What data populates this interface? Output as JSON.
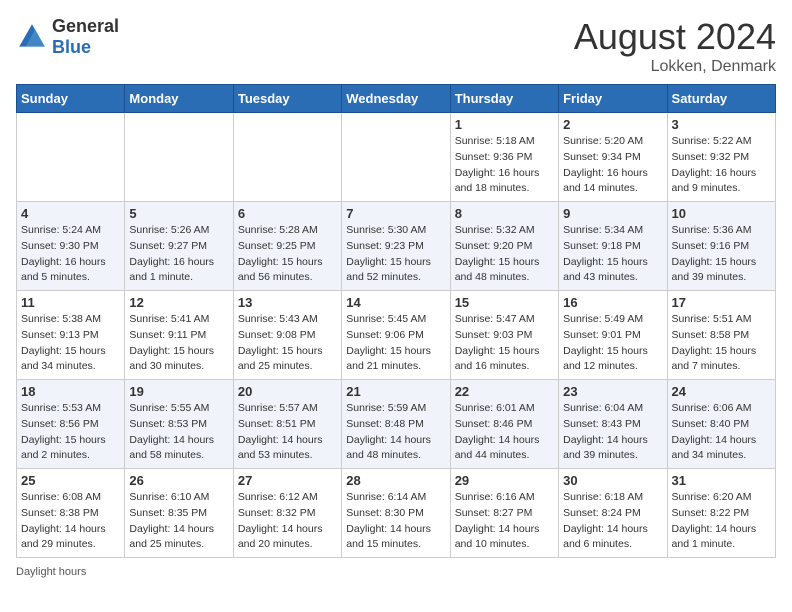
{
  "header": {
    "logo_general": "General",
    "logo_blue": "Blue",
    "month_year": "August 2024",
    "location": "Lokken, Denmark"
  },
  "footer": {
    "daylight_label": "Daylight hours"
  },
  "columns": [
    "Sunday",
    "Monday",
    "Tuesday",
    "Wednesday",
    "Thursday",
    "Friday",
    "Saturday"
  ],
  "weeks": [
    [
      {
        "day": "",
        "info": ""
      },
      {
        "day": "",
        "info": ""
      },
      {
        "day": "",
        "info": ""
      },
      {
        "day": "",
        "info": ""
      },
      {
        "day": "1",
        "info": "Sunrise: 5:18 AM\nSunset: 9:36 PM\nDaylight: 16 hours\nand 18 minutes."
      },
      {
        "day": "2",
        "info": "Sunrise: 5:20 AM\nSunset: 9:34 PM\nDaylight: 16 hours\nand 14 minutes."
      },
      {
        "day": "3",
        "info": "Sunrise: 5:22 AM\nSunset: 9:32 PM\nDaylight: 16 hours\nand 9 minutes."
      }
    ],
    [
      {
        "day": "4",
        "info": "Sunrise: 5:24 AM\nSunset: 9:30 PM\nDaylight: 16 hours\nand 5 minutes."
      },
      {
        "day": "5",
        "info": "Sunrise: 5:26 AM\nSunset: 9:27 PM\nDaylight: 16 hours\nand 1 minute."
      },
      {
        "day": "6",
        "info": "Sunrise: 5:28 AM\nSunset: 9:25 PM\nDaylight: 15 hours\nand 56 minutes."
      },
      {
        "day": "7",
        "info": "Sunrise: 5:30 AM\nSunset: 9:23 PM\nDaylight: 15 hours\nand 52 minutes."
      },
      {
        "day": "8",
        "info": "Sunrise: 5:32 AM\nSunset: 9:20 PM\nDaylight: 15 hours\nand 48 minutes."
      },
      {
        "day": "9",
        "info": "Sunrise: 5:34 AM\nSunset: 9:18 PM\nDaylight: 15 hours\nand 43 minutes."
      },
      {
        "day": "10",
        "info": "Sunrise: 5:36 AM\nSunset: 9:16 PM\nDaylight: 15 hours\nand 39 minutes."
      }
    ],
    [
      {
        "day": "11",
        "info": "Sunrise: 5:38 AM\nSunset: 9:13 PM\nDaylight: 15 hours\nand 34 minutes."
      },
      {
        "day": "12",
        "info": "Sunrise: 5:41 AM\nSunset: 9:11 PM\nDaylight: 15 hours\nand 30 minutes."
      },
      {
        "day": "13",
        "info": "Sunrise: 5:43 AM\nSunset: 9:08 PM\nDaylight: 15 hours\nand 25 minutes."
      },
      {
        "day": "14",
        "info": "Sunrise: 5:45 AM\nSunset: 9:06 PM\nDaylight: 15 hours\nand 21 minutes."
      },
      {
        "day": "15",
        "info": "Sunrise: 5:47 AM\nSunset: 9:03 PM\nDaylight: 15 hours\nand 16 minutes."
      },
      {
        "day": "16",
        "info": "Sunrise: 5:49 AM\nSunset: 9:01 PM\nDaylight: 15 hours\nand 12 minutes."
      },
      {
        "day": "17",
        "info": "Sunrise: 5:51 AM\nSunset: 8:58 PM\nDaylight: 15 hours\nand 7 minutes."
      }
    ],
    [
      {
        "day": "18",
        "info": "Sunrise: 5:53 AM\nSunset: 8:56 PM\nDaylight: 15 hours\nand 2 minutes."
      },
      {
        "day": "19",
        "info": "Sunrise: 5:55 AM\nSunset: 8:53 PM\nDaylight: 14 hours\nand 58 minutes."
      },
      {
        "day": "20",
        "info": "Sunrise: 5:57 AM\nSunset: 8:51 PM\nDaylight: 14 hours\nand 53 minutes."
      },
      {
        "day": "21",
        "info": "Sunrise: 5:59 AM\nSunset: 8:48 PM\nDaylight: 14 hours\nand 48 minutes."
      },
      {
        "day": "22",
        "info": "Sunrise: 6:01 AM\nSunset: 8:46 PM\nDaylight: 14 hours\nand 44 minutes."
      },
      {
        "day": "23",
        "info": "Sunrise: 6:04 AM\nSunset: 8:43 PM\nDaylight: 14 hours\nand 39 minutes."
      },
      {
        "day": "24",
        "info": "Sunrise: 6:06 AM\nSunset: 8:40 PM\nDaylight: 14 hours\nand 34 minutes."
      }
    ],
    [
      {
        "day": "25",
        "info": "Sunrise: 6:08 AM\nSunset: 8:38 PM\nDaylight: 14 hours\nand 29 minutes."
      },
      {
        "day": "26",
        "info": "Sunrise: 6:10 AM\nSunset: 8:35 PM\nDaylight: 14 hours\nand 25 minutes."
      },
      {
        "day": "27",
        "info": "Sunrise: 6:12 AM\nSunset: 8:32 PM\nDaylight: 14 hours\nand 20 minutes."
      },
      {
        "day": "28",
        "info": "Sunrise: 6:14 AM\nSunset: 8:30 PM\nDaylight: 14 hours\nand 15 minutes."
      },
      {
        "day": "29",
        "info": "Sunrise: 6:16 AM\nSunset: 8:27 PM\nDaylight: 14 hours\nand 10 minutes."
      },
      {
        "day": "30",
        "info": "Sunrise: 6:18 AM\nSunset: 8:24 PM\nDaylight: 14 hours\nand 6 minutes."
      },
      {
        "day": "31",
        "info": "Sunrise: 6:20 AM\nSunset: 8:22 PM\nDaylight: 14 hours\nand 1 minute."
      }
    ]
  ]
}
